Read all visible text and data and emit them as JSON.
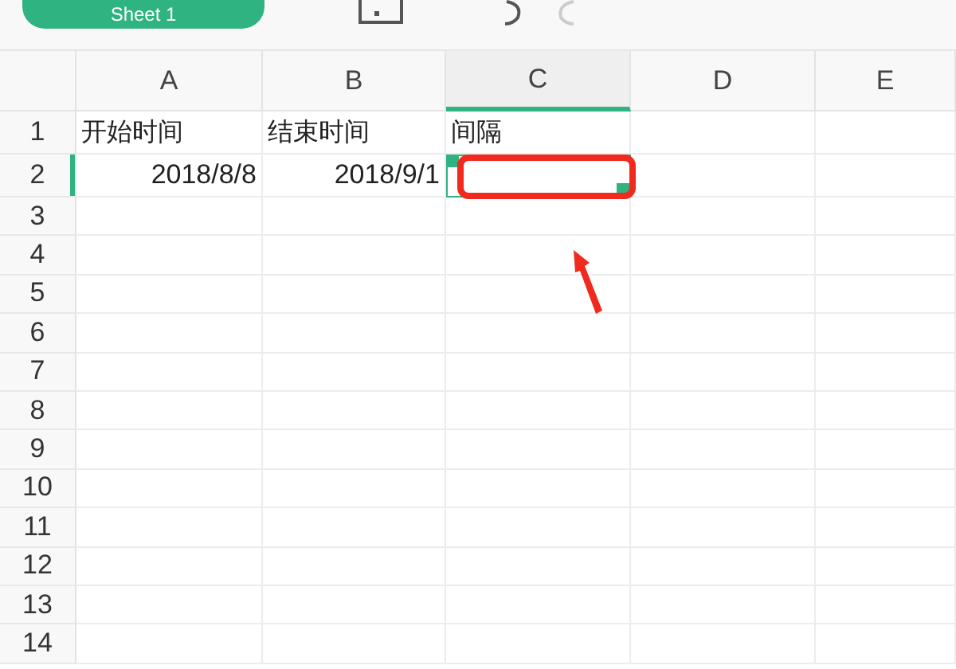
{
  "sheet_tab": {
    "label": "Sheet 1"
  },
  "columns": [
    {
      "label": "A",
      "selected": false
    },
    {
      "label": "B",
      "selected": false
    },
    {
      "label": "C",
      "selected": true
    },
    {
      "label": "D",
      "selected": false
    },
    {
      "label": "E",
      "selected": false
    }
  ],
  "rows": [
    {
      "number": "1",
      "selected": false,
      "cells": [
        {
          "text": "开始时间",
          "kind": "text"
        },
        {
          "text": "结束时间",
          "kind": "text"
        },
        {
          "text": "间隔",
          "kind": "text"
        }
      ]
    },
    {
      "number": "2",
      "selected": true,
      "cells": [
        {
          "text": "2018/8/8",
          "kind": "date"
        },
        {
          "text": "2018/9/1",
          "kind": "date"
        }
      ]
    },
    {
      "number": "3",
      "selected": false,
      "cells": []
    },
    {
      "number": "4",
      "selected": false,
      "cells": []
    },
    {
      "number": "5",
      "selected": false,
      "cells": []
    },
    {
      "number": "6",
      "selected": false,
      "cells": []
    },
    {
      "number": "7",
      "selected": false,
      "cells": []
    },
    {
      "number": "8",
      "selected": false,
      "cells": []
    },
    {
      "number": "9",
      "selected": false,
      "cells": []
    },
    {
      "number": "10",
      "selected": false,
      "cells": []
    },
    {
      "number": "11",
      "selected": false,
      "cells": []
    },
    {
      "number": "12",
      "selected": false,
      "cells": []
    },
    {
      "number": "13",
      "selected": false,
      "cells": []
    },
    {
      "number": "14",
      "selected": false,
      "cells": []
    }
  ]
}
